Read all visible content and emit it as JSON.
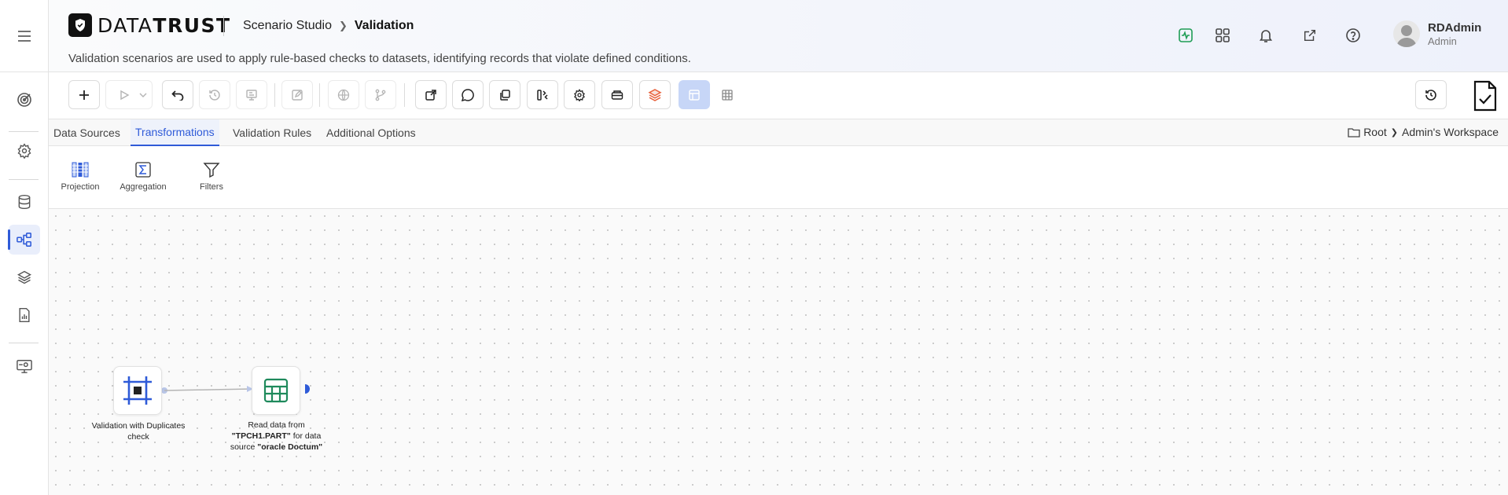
{
  "app": {
    "logo_part1": "DATA",
    "logo_part2": "TRUST"
  },
  "breadcrumb": {
    "parent": "Scenario Studio",
    "current": "Validation"
  },
  "description": "Validation scenarios are used to apply rule-based checks to datasets, identifying records that violate defined conditions.",
  "user": {
    "name": "RDAdmin",
    "role": "Admin"
  },
  "header_icons": [
    "activity-icon",
    "apps-grid-icon",
    "bell-icon",
    "external-link-icon",
    "help-icon"
  ],
  "sidebar": {
    "items": [
      {
        "icon": "target-icon"
      },
      {
        "icon": "settings-icon"
      },
      {
        "icon": "database-icon"
      },
      {
        "icon": "flow-icon",
        "active": true
      },
      {
        "icon": "layers-icon"
      },
      {
        "icon": "report-icon"
      },
      {
        "icon": "monitor-icon"
      }
    ]
  },
  "tabs": [
    {
      "label": "Data Sources"
    },
    {
      "label": "Transformations",
      "active": true
    },
    {
      "label": "Validation Rules"
    },
    {
      "label": "Additional Options"
    }
  ],
  "workspace_path": {
    "root": "Root",
    "folder": "Admin's Workspace"
  },
  "transformations": [
    {
      "label": "Projection",
      "icon": "projection-icon"
    },
    {
      "label": "Aggregation",
      "icon": "sigma-icon"
    },
    {
      "label": "Filters",
      "icon": "filter-icon"
    }
  ],
  "nodes": [
    {
      "label": "Validation with Duplicates check",
      "icon": "validation-frame-icon"
    },
    {
      "label_prefix": "Read data from ",
      "table": "\"TPCH1.PART\"",
      "label_mid": " for data source ",
      "source": "\"oracle Doctum\"",
      "icon": "table-icon"
    }
  ],
  "colors": {
    "accent": "#2f5bd8",
    "selected_tool": "#c7d6f7",
    "table_icon": "#1f8a5c",
    "activity_icon": "#1f9d55",
    "layers_icon": "#e8623c"
  }
}
